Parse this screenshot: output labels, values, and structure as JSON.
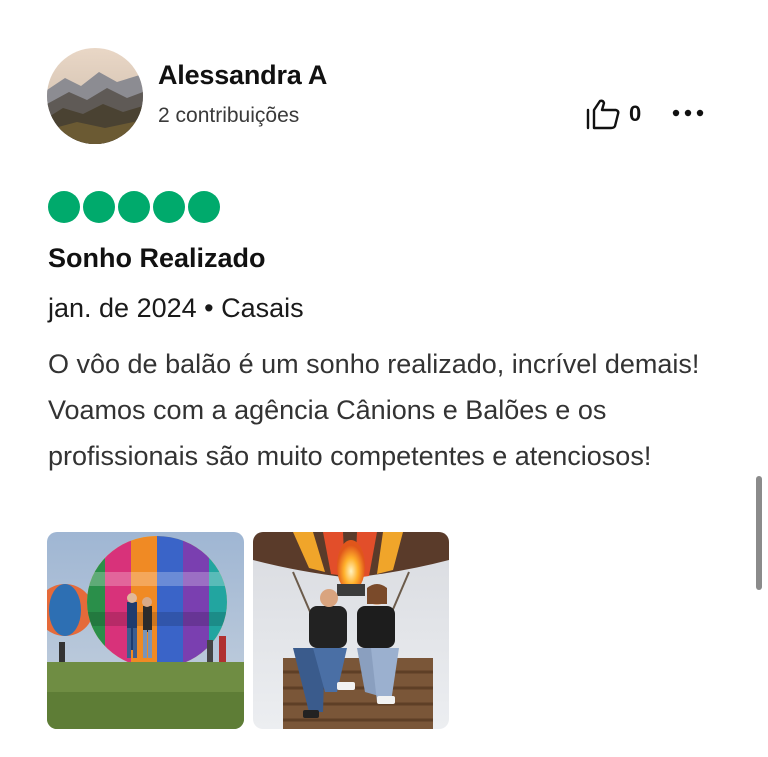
{
  "review": {
    "user": {
      "name": "Alessandra A",
      "contributions": "2 contribuições"
    },
    "helpful_count": "0",
    "rating": 5,
    "title": "Sonho Realizado",
    "date": "jan. de 2024",
    "separator": " • ",
    "trip_type": "Casais",
    "text": "O vôo de balão é um sonho realizado, incrível demais! Voamos com a agência Cânions e Balões e os profissionais são muito competentes e atenciosos!"
  },
  "icons": {
    "helpful": "thumbs-up-outline-icon",
    "more": "three-dots-icon",
    "rating": "filled-bubble-icon"
  },
  "colors": {
    "rating_green": "#00aa6c",
    "text_dark": "#111111",
    "text_muted": "#3a3a3a"
  }
}
